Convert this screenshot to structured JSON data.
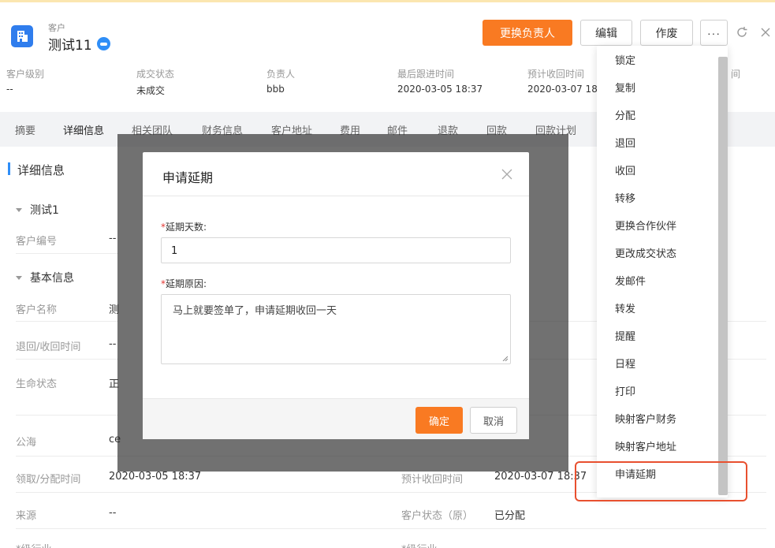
{
  "header": {
    "object_type": "客户",
    "object_name": "测试11",
    "buttons": {
      "change_owner": "更换负责人",
      "edit": "编辑",
      "void": "作废",
      "more": "···"
    }
  },
  "info_strip": [
    {
      "label": "客户级别",
      "value": "--"
    },
    {
      "label": "成交状态",
      "value": "未成交"
    },
    {
      "label": "负责人",
      "value": "bbb"
    },
    {
      "label": "最后跟进时间",
      "value": "2020-03-05 18:37"
    },
    {
      "label": "预计收回时间",
      "value": "2020-03-07 18:"
    }
  ],
  "info_strip_truncated": "间",
  "tabs": [
    "摘要",
    "详细信息",
    "相关团队",
    "财务信息",
    "客户地址",
    "费用",
    "邮件",
    "退款",
    "回款",
    "回款计划"
  ],
  "detail": {
    "section_title": "详细信息",
    "group1": "测试1",
    "group2": "基本信息",
    "fields": {
      "customer_no_label": "客户编号",
      "customer_no_value": "--",
      "customer_name_label": "客户名称",
      "customer_name_value": "测",
      "return_time_label": "退回/收回时间",
      "return_time_value": "--",
      "life_status_label": "生命状态",
      "life_status_value": "正",
      "pool_label": "公海",
      "pool_value": "ce",
      "assign_time_label": "领取/分配时间",
      "assign_time_value": "2020-03-05 18:37",
      "source_label": "来源",
      "source_value": "--",
      "industry_label": "*级行业",
      "industry2_label": "*级行业",
      "expected_return_label": "预计收回时间",
      "expected_return_value": "2020-03-07 18:37",
      "customer_status_label": "客户状态（原）",
      "customer_status_value": "已分配"
    }
  },
  "modal": {
    "title": "申请延期",
    "days_label": "延期天数:",
    "days_value": "1",
    "reason_label": "延期原因:",
    "reason_value": "马上就要签单了，申请延期收回一天",
    "required_mark": "*",
    "confirm": "确定",
    "cancel": "取消"
  },
  "dropdown": {
    "items": [
      "锁定",
      "复制",
      "分配",
      "退回",
      "收回",
      "转移",
      "更换合作伙伴",
      "更改成交状态",
      "发邮件",
      "转发",
      "提醒",
      "日程",
      "打印",
      "映射客户财务",
      "映射客户地址",
      "申请延期"
    ],
    "highlighted": "申请延期"
  },
  "colors": {
    "accent_orange": "#f97a22",
    "brand_blue": "#2f7ded",
    "highlight_red": "#e8502f"
  }
}
